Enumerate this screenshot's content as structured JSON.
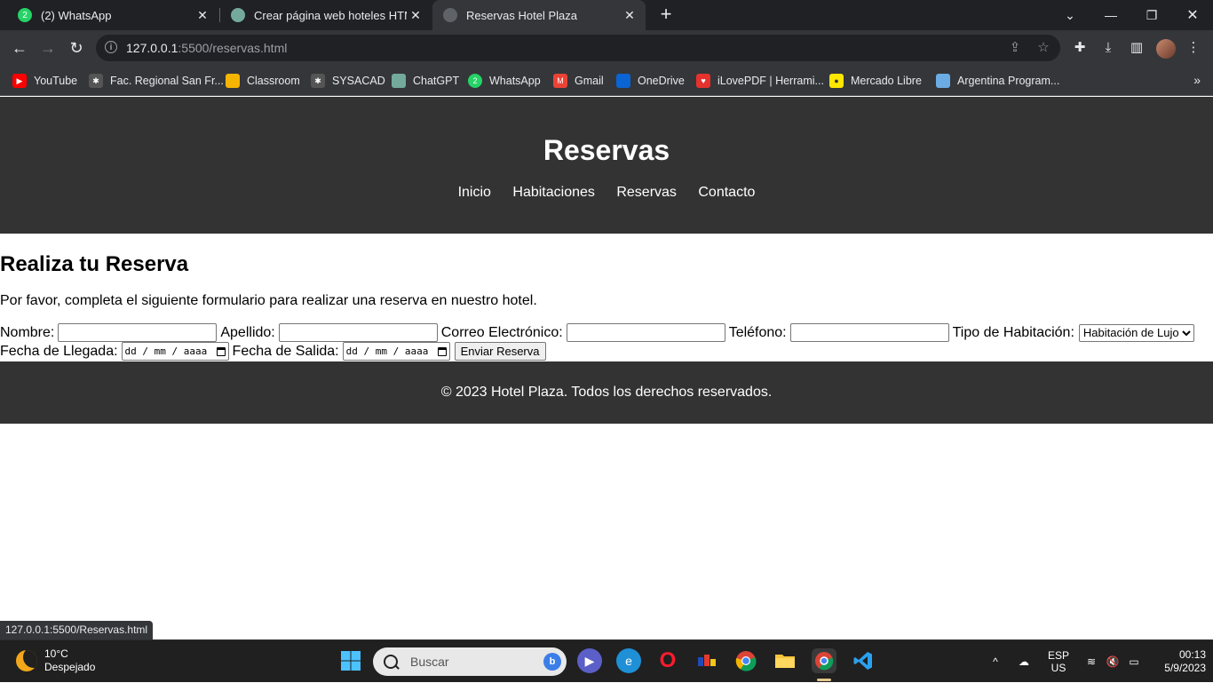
{
  "browser": {
    "tabs": [
      {
        "title": "(2) WhatsApp",
        "icon": "whatsapp-icon",
        "color": "#25d366",
        "badge": "2"
      },
      {
        "title": "Crear página web hoteles HTML/",
        "icon": "chatgpt-icon",
        "color": "#74aa9c"
      },
      {
        "title": "Reservas Hotel Plaza",
        "icon": "globe-icon",
        "color": "#5f6368"
      }
    ],
    "url_host": "127.0.0.1",
    "url_rest": ":5500/reservas.html",
    "bookmarks": [
      {
        "label": "YouTube",
        "icon": "youtube-icon",
        "color": "#ff0000"
      },
      {
        "label": "Fac. Regional San Fr...",
        "icon": "utn-icon",
        "color": "#555555"
      },
      {
        "label": "Classroom",
        "icon": "classroom-icon",
        "color": "#f4b400"
      },
      {
        "label": "SYSACAD",
        "icon": "sysacad-icon",
        "color": "#555555"
      },
      {
        "label": "ChatGPT",
        "icon": "chatgpt-icon",
        "color": "#74aa9c"
      },
      {
        "label": "WhatsApp",
        "icon": "whatsapp-icon",
        "color": "#25d366"
      },
      {
        "label": "Gmail",
        "icon": "gmail-icon",
        "color": "#ea4335"
      },
      {
        "label": "OneDrive",
        "icon": "onedrive-icon",
        "color": "#0a64d4"
      },
      {
        "label": "iLovePDF | Herrami...",
        "icon": "ilovepdf-icon",
        "color": "#e5322d"
      },
      {
        "label": "Mercado Libre",
        "icon": "mercadolibre-icon",
        "color": "#ffe600"
      },
      {
        "label": "Argentina Program...",
        "icon": "argentina-program-icon",
        "color": "#6cace4"
      }
    ]
  },
  "site": {
    "title": "Reservas",
    "nav": [
      "Inicio",
      "Habitaciones",
      "Reservas",
      "Contacto"
    ],
    "heading": "Realiza tu Reserva",
    "intro": "Por favor, completa el siguiente formulario para realizar una reserva en nuestro hotel.",
    "form": {
      "nombre_label": "Nombre:",
      "apellido_label": "Apellido:",
      "correo_label": "Correo Electrónico:",
      "telefono_label": "Teléfono:",
      "tipo_label": "Tipo de Habitación:",
      "tipo_selected": "Habitación de Lujo",
      "llegada_label": "Fecha de Llegada:",
      "salida_label": "Fecha de Salida:",
      "date_placeholder": "dd / mm / aaaa",
      "submit_label": "Enviar Reserva"
    },
    "footer": "© 2023 Hotel Plaza. Todos los derechos reservados."
  },
  "status_url": "127.0.0.1:5500/Reservas.html",
  "taskbar": {
    "temperature": "10°C",
    "weather": "Despejado",
    "search_placeholder": "Buscar",
    "lang_top": "ESP",
    "lang_bottom": "US",
    "time": "00:13",
    "date": "5/9/2023"
  },
  "colors": {
    "site_header_bg": "#333333",
    "chrome_dark": "#202124",
    "chrome_toolbar": "#35363a"
  }
}
